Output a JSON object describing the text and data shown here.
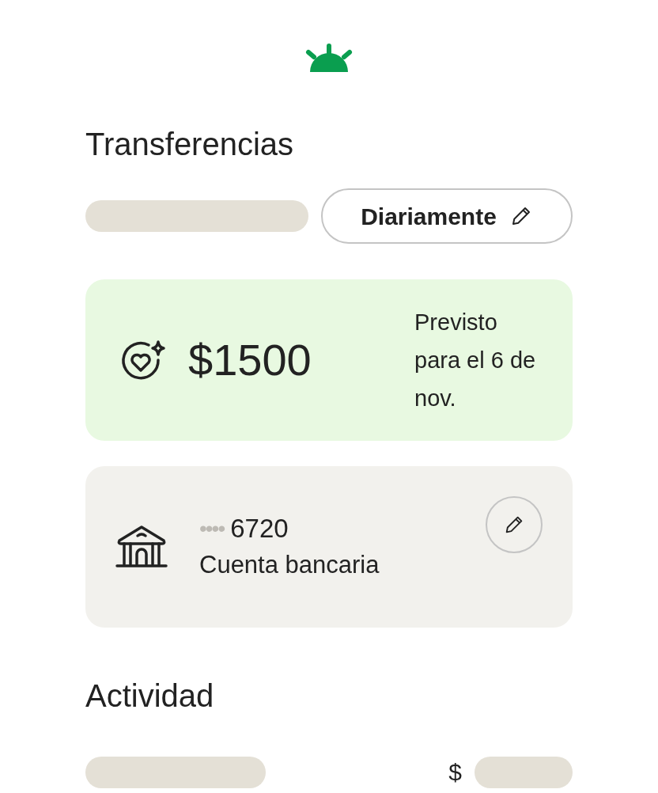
{
  "header": {
    "title": "Transferencias"
  },
  "frequency_button": {
    "label": "Diariamente"
  },
  "scheduled_card": {
    "amount": "$1500",
    "note": "Previsto para el 6 de nov."
  },
  "account_card": {
    "mask": "••••",
    "number": "6720",
    "label": "Cuenta bancaria"
  },
  "activity": {
    "title": "Actividad",
    "currency": "$"
  }
}
